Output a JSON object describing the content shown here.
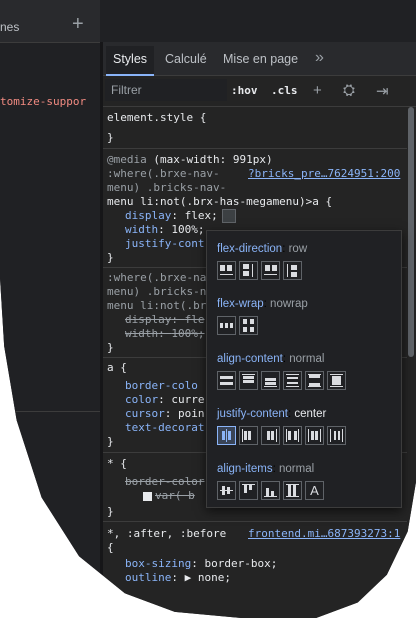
{
  "left_panel": {
    "tab_label": "nes",
    "code_line": "tomize-suppor"
  },
  "tabs": [
    "Styles",
    "Calculé",
    "Mise en page"
  ],
  "filter": {
    "placeholder": "Filtrer",
    "hov": ":hov",
    "cls": ".cls"
  },
  "rules": {
    "element_style": "element.style {",
    "close": "}",
    "media": "@media",
    "media_query": "(max-width: 991px)",
    "rule1_sel": [
      ":where(.brxe-nav-",
      "menu) .bricks-nav-",
      "menu li:not(.brx-has-megamenu)>a {"
    ],
    "rule1_link": "?bricks_pre…7624951:200",
    "rule1_props": [
      {
        "p": "display",
        "v": "flex;"
      },
      {
        "p": "width",
        "v": "100%;"
      },
      {
        "p": "justify-cont",
        "v": ""
      }
    ],
    "rule2_sel": [
      ":where(.brxe-na",
      "menu) .bricks-n",
      "menu li:not(.br"
    ],
    "rule2_props": [
      {
        "p": "display",
        "v": "fle"
      },
      {
        "p": "width",
        "v": "100%;"
      }
    ],
    "rule3_sel": "a {",
    "rule3_props": [
      {
        "p": "border-colo",
        "v": ""
      },
      {
        "p": "color",
        "v": "curre"
      },
      {
        "p": "cursor",
        "v": "poin"
      },
      {
        "p": "text-decorat",
        "v": ""
      }
    ],
    "rule4_sel": "* {",
    "rule4_props": [
      {
        "p": "border-color",
        "v": ""
      },
      {
        "p": "",
        "v": "var( b"
      }
    ],
    "rule5_sel": "*, :after, :before",
    "rule5_link": "frontend.mi…687393273:1",
    "rule5_open": "{",
    "rule5_props": [
      {
        "p": "box-sizing",
        "v": "border-box;"
      },
      {
        "p": "outline",
        "v": "▶ none;"
      }
    ]
  },
  "flexbox_editor": {
    "groups": [
      {
        "name": "flex-direction",
        "value": "row",
        "buttons": 4
      },
      {
        "name": "flex-wrap",
        "value": "nowrap",
        "buttons": 2
      },
      {
        "name": "align-content",
        "value": "normal",
        "buttons": 6
      },
      {
        "name": "justify-content",
        "value": "center",
        "buttons": 6
      },
      {
        "name": "align-items",
        "value": "normal",
        "buttons": 5
      }
    ]
  }
}
